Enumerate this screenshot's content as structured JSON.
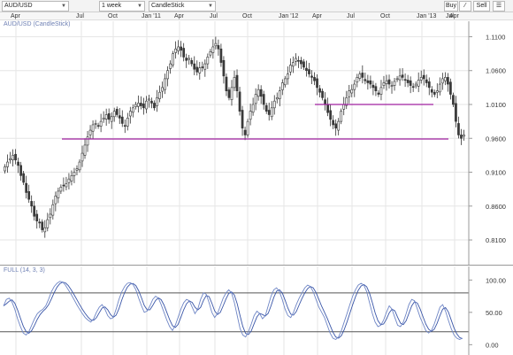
{
  "toolbar": {
    "symbol": "AUD/USD",
    "timeframe": "1 week",
    "chart_style": "CandleStick",
    "buy_label": "Buy",
    "sell_label": "Sell"
  },
  "x_tick_labels": [
    "Apr",
    "Jul",
    "Oct",
    "Jan '11",
    "Apr",
    "Jul",
    "Oct",
    "Jan '12",
    "Apr",
    "Jul",
    "Oct",
    "Jan '13",
    "Apr",
    "Jul"
  ],
  "colors": {
    "up": "#ffffff",
    "down": "#3b3b3b",
    "hline": "#a020a0",
    "stoch_k": "#6f86c6",
    "stoch_d": "#3a56a8",
    "grid": "#e6e6e6"
  },
  "chart_data": [
    {
      "type": "candlestick",
      "title": "AUD/USD (CandleStick)",
      "y_ticks": [
        "1.1100",
        "1.0600",
        "1.0100",
        "0.9600",
        "0.9100",
        "0.8600",
        "0.8100"
      ],
      "ylim": [
        0.78,
        1.125
      ],
      "grid": true,
      "close_approx": [
        0.918,
        0.925,
        0.93,
        0.935,
        0.928,
        0.92,
        0.905,
        0.895,
        0.88,
        0.87,
        0.86,
        0.845,
        0.838,
        0.835,
        0.825,
        0.828,
        0.84,
        0.848,
        0.862,
        0.875,
        0.882,
        0.888,
        0.89,
        0.893,
        0.9,
        0.905,
        0.91,
        0.915,
        0.925,
        0.938,
        0.95,
        0.962,
        0.972,
        0.98,
        0.982,
        0.978,
        0.985,
        0.99,
        0.995,
        0.988,
        0.992,
        1.0,
        0.995,
        0.99,
        0.982,
        0.978,
        0.99,
        1.0,
        1.005,
        1.01,
        1.012,
        1.008,
        1.005,
        1.015,
        1.018,
        1.012,
        1.005,
        1.02,
        1.028,
        1.035,
        1.048,
        1.06,
        1.07,
        1.085,
        1.092,
        1.095,
        1.09,
        1.08,
        1.075,
        1.078,
        1.07,
        1.062,
        1.058,
        1.064,
        1.065,
        1.07,
        1.08,
        1.088,
        1.095,
        1.1,
        1.092,
        1.072,
        1.052,
        1.03,
        1.02,
        1.035,
        1.05,
        1.03,
        1.0,
        0.975,
        0.965,
        0.985,
        1.0,
        1.01,
        1.025,
        1.032,
        1.022,
        1.01,
        1.0,
        0.995,
        1.005,
        1.015,
        1.02,
        1.03,
        1.042,
        1.048,
        1.055,
        1.068,
        1.072,
        1.078,
        1.075,
        1.07,
        1.065,
        1.06,
        1.055,
        1.05,
        1.045,
        1.035,
        1.028,
        1.02,
        1.01,
        0.998,
        0.988,
        0.98,
        0.975,
        0.985,
        1.0,
        1.01,
        1.02,
        1.03,
        1.032,
        1.04,
        1.05,
        1.055,
        1.05,
        1.045,
        1.042,
        1.04,
        1.035,
        1.03,
        1.025,
        1.035,
        1.042,
        1.045,
        1.04,
        1.038,
        1.044,
        1.048,
        1.052,
        1.05,
        1.046,
        1.042,
        1.038,
        1.036,
        1.04,
        1.046,
        1.05,
        1.048,
        1.042,
        1.035,
        1.028,
        1.025,
        1.03,
        1.04,
        1.048,
        1.05,
        1.04,
        1.025,
        1.01,
        0.985,
        0.965,
        0.96,
        0.965
      ]
    },
    {
      "type": "line",
      "title": "FULL (14, 3, 3)",
      "y_ticks": [
        "100.00",
        "50.00",
        "0.00"
      ],
      "ylim": [
        -5,
        110
      ],
      "levels": [
        80,
        20
      ],
      "series": [
        {
          "values": [
            60,
            70,
            72,
            66,
            55,
            40,
            28,
            18,
            15,
            20,
            30,
            40,
            48,
            52,
            55,
            60,
            70,
            82,
            90,
            95,
            98,
            97,
            92,
            85,
            78,
            70,
            62,
            55,
            48,
            42,
            38,
            35,
            40,
            50,
            58,
            62,
            55,
            45,
            40,
            42,
            55,
            70,
            82,
            90,
            95,
            96,
            93,
            85,
            72,
            60,
            50,
            52,
            60,
            70,
            75,
            72,
            62,
            50,
            38,
            28,
            22,
            30,
            42,
            55,
            65,
            70,
            68,
            58,
            48,
            55,
            70,
            80,
            78,
            65,
            50,
            42,
            48,
            60,
            72,
            80,
            85,
            80,
            65,
            45,
            25,
            15,
            12,
            20,
            32,
            45,
            52,
            48,
            40,
            45,
            60,
            75,
            85,
            88,
            82,
            70,
            55,
            45,
            42,
            50,
            62,
            72,
            80,
            88,
            92,
            90,
            82,
            70,
            58,
            50,
            42,
            30,
            18,
            10,
            8,
            12,
            22,
            35,
            48,
            62,
            75,
            85,
            92,
            95,
            92,
            82,
            65,
            48,
            35,
            28,
            30,
            38,
            50,
            60,
            55,
            42,
            30,
            28,
            35,
            48,
            62,
            70,
            68,
            55,
            42,
            32,
            22,
            18,
            22,
            32,
            45,
            58,
            62,
            52,
            38,
            25,
            15,
            10,
            8,
            10
          ]
        }
      ]
    }
  ]
}
